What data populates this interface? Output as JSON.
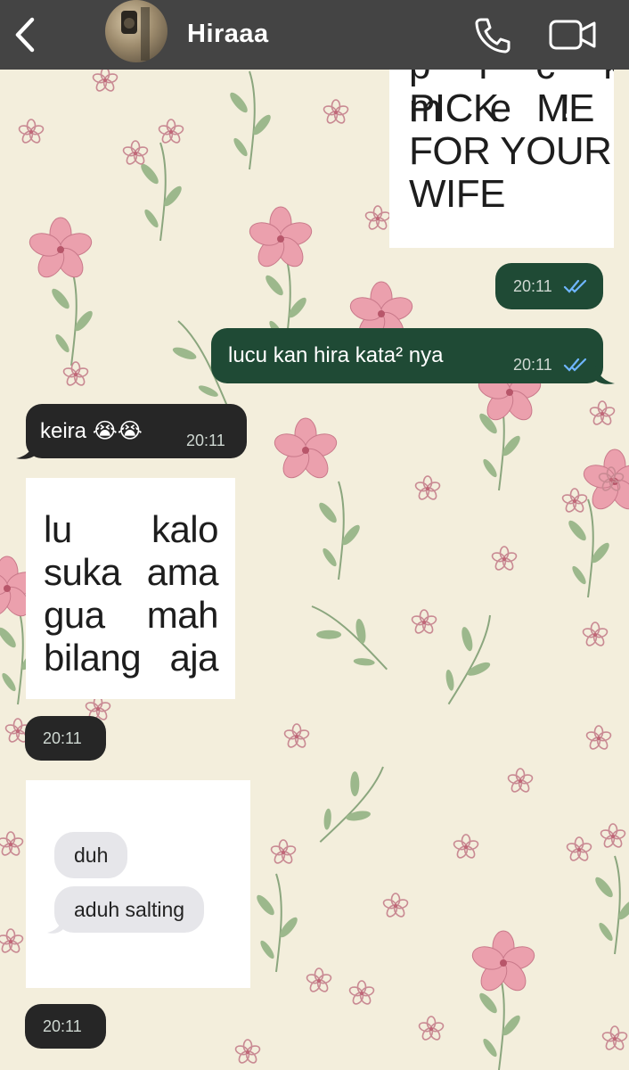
{
  "header": {
    "contact_name": "Hiraaa",
    "icons": [
      "back-arrow-icon",
      "call-icon",
      "video-call-icon"
    ]
  },
  "messages": {
    "sticker_top_partial": "pick me!",
    "sticker_top_line1_left": "PICK",
    "sticker_top_line1_right": "ME",
    "sticker_top_line2": "FOR YOUR",
    "sticker_top_line3": "WIFE",
    "sticker_top_time": "20:11",
    "outgoing_text": "lucu kan hira kata² nya",
    "outgoing_time": "20:11",
    "incoming_text": "keira 😭😭",
    "incoming_time": "20:11",
    "sticker2_words": [
      [
        "lu",
        "kalo"
      ],
      [
        "suka",
        "ama"
      ],
      [
        "gua",
        "mah"
      ],
      [
        "bilang",
        "aja"
      ]
    ],
    "sticker2_time": "20:11",
    "screenshot_bubbles": [
      "duh",
      "aduh salting"
    ],
    "screenshot_time": "20:11"
  },
  "colors": {
    "header_bg": "#444444",
    "outgoing_bubble": "#1f4a35",
    "incoming_bubble": "#262626",
    "wallpaper": "#f3eedc",
    "read_ticks": "#6fb6ff"
  }
}
